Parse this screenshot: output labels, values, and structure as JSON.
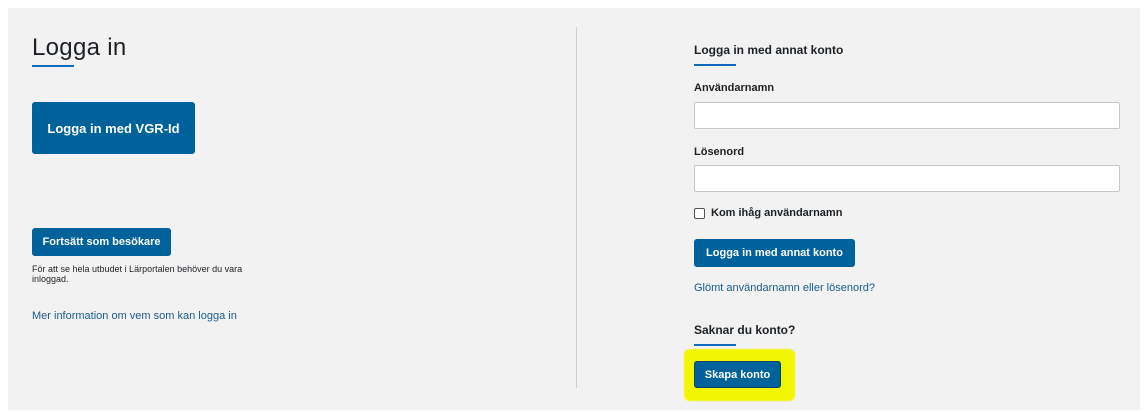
{
  "login": {
    "title": "Logga in",
    "vgr_button": "Logga in med VGR-Id",
    "guest_button": "Fortsätt som besökare",
    "guest_note": "För att se hela utbudet i Lärportalen behöver du vara inloggad.",
    "more_info_link": "Mer information om vem som kan logga in"
  },
  "alt_login": {
    "title": "Logga in med annat konto",
    "username_label": "Användarnamn",
    "username_value": "",
    "password_label": "Lösenord",
    "password_value": "",
    "remember_label": "Kom ihåg användarnamn",
    "remember_checked": false,
    "submit_button": "Logga in med annat konto",
    "forgot_link": "Glömt användarnamn eller lösenord?"
  },
  "signup": {
    "title": "Saknar du konto?",
    "create_button": "Skapa konto"
  },
  "colors": {
    "primary_button": "#00629b",
    "link": "#1a5c8a",
    "underline_accent": "#0f6cbf",
    "card_background": "#f2f2f2",
    "highlight": "#f2f600"
  }
}
